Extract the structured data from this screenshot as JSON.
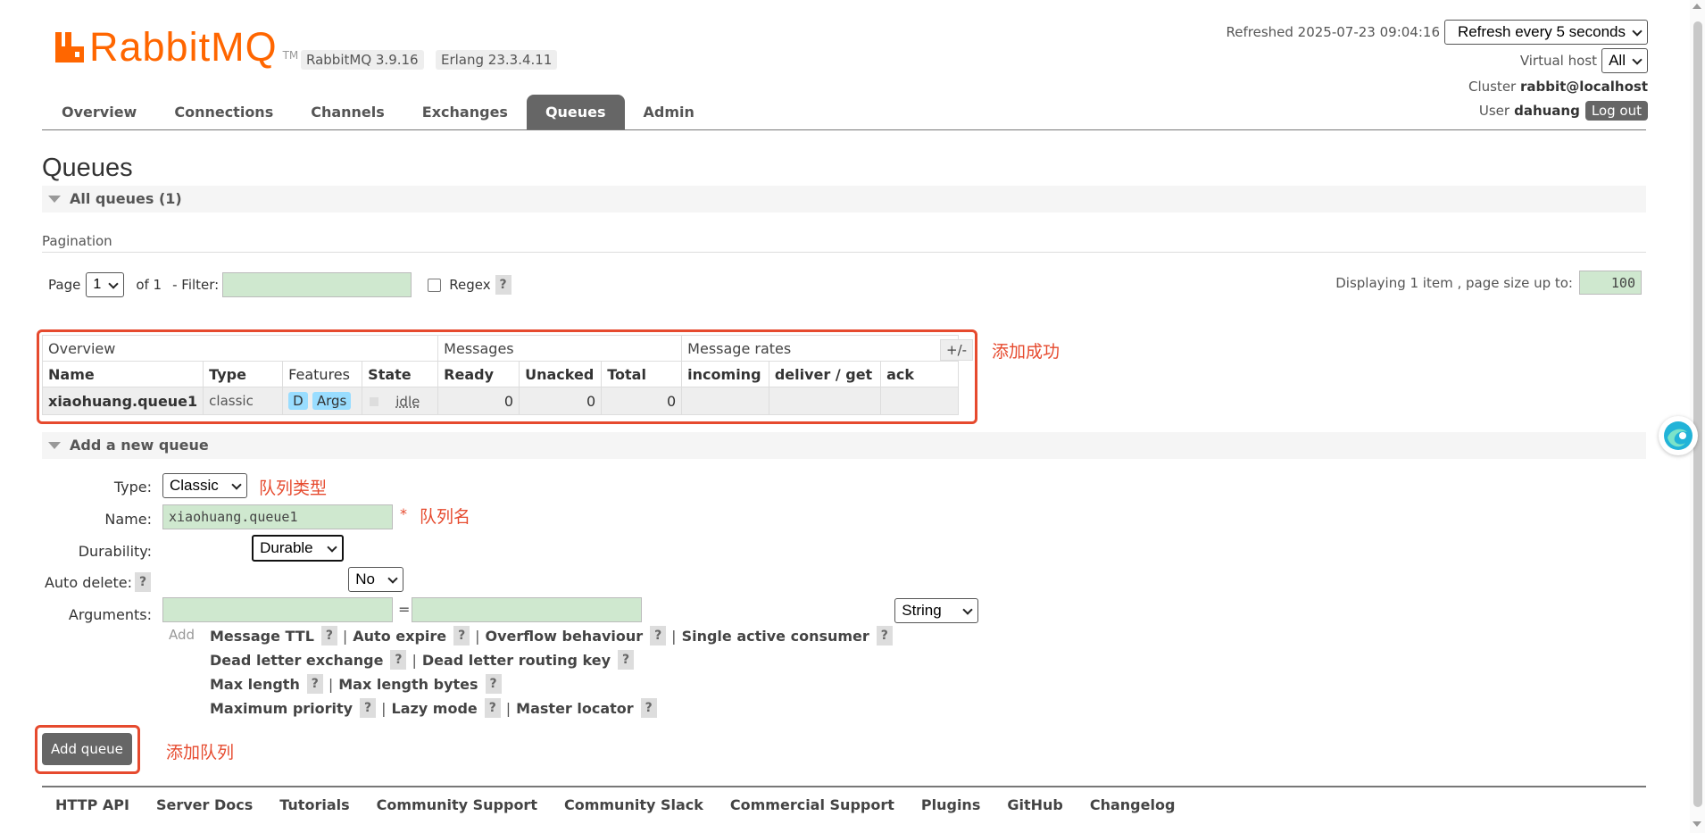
{
  "header": {
    "logo_rabbit": "RabbitMQ",
    "logo_tm": "TM",
    "version_rabbitmq": "RabbitMQ 3.9.16",
    "version_erlang": "Erlang 23.3.4.11",
    "refreshed_label": "Refreshed 2025-07-23 09:04:16",
    "refresh_select": "Refresh every 5 seconds",
    "vhost_label": "Virtual host",
    "vhost_select": "All",
    "cluster_label": "Cluster",
    "cluster_value": "rabbit@localhost",
    "user_label": "User",
    "user_value": "dahuang",
    "logout": "Log out"
  },
  "nav": {
    "tabs": [
      "Overview",
      "Connections",
      "Channels",
      "Exchanges",
      "Queues",
      "Admin"
    ],
    "active": "Queues"
  },
  "page": {
    "title": "Queues",
    "all_queues": "All queues (1)"
  },
  "pagination": {
    "heading": "Pagination",
    "page_label": "Page",
    "page_select": "1",
    "of_label": "of 1",
    "filter_label": "- Filter:",
    "filter_value": "",
    "regex_label": "Regex",
    "help": "?",
    "displaying": "Displaying 1 item , page size up to:",
    "page_size": "100"
  },
  "table": {
    "groups": [
      "Overview",
      "Messages",
      "Message rates"
    ],
    "plusminus": "+/-",
    "columns": [
      "Name",
      "Type",
      "Features",
      "State",
      "Ready",
      "Unacked",
      "Total",
      "incoming",
      "deliver / get",
      "ack"
    ],
    "rows": [
      {
        "name": "xiaohuang.queue1",
        "type": "classic",
        "feature_d": "D",
        "feature_args": "Args",
        "state": "idle",
        "ready": "0",
        "unacked": "0",
        "total": "0",
        "incoming": "",
        "deliver_get": "",
        "ack": ""
      }
    ]
  },
  "annotations": {
    "table": "添加成功",
    "type": "队列类型",
    "name": "队列名",
    "button": "添加队列"
  },
  "add_queue": {
    "heading": "Add a new queue",
    "type_label": "Type:",
    "type_value": "Classic",
    "name_label": "Name:",
    "name_value": "xiaohuang.queue1",
    "required_mark": "*",
    "durability_label": "Durability:",
    "durability_value": "Durable",
    "auto_delete_label": "Auto delete:",
    "auto_delete_value": "No",
    "arguments_label": "Arguments:",
    "arg_equals": "=",
    "arg_type": "String",
    "add_label": "Add",
    "arg_lines": [
      [
        "Message TTL",
        "Auto expire",
        "Overflow behaviour",
        "Single active consumer"
      ],
      [
        "Dead letter exchange",
        "Dead letter routing key"
      ],
      [
        "Max length",
        "Max length bytes"
      ],
      [
        "Maximum priority",
        "Lazy mode",
        "Master locator"
      ]
    ],
    "submit": "Add queue"
  },
  "footer": {
    "links": [
      "HTTP API",
      "Server Docs",
      "Tutorials",
      "Community Support",
      "Community Slack",
      "Commercial Support",
      "Plugins",
      "GitHub",
      "Changelog"
    ]
  },
  "colors": {
    "brand_orange": "#ff6600",
    "annotation_red": "#e64a2e",
    "input_green": "#cfe8cf",
    "nav_active": "#666666"
  }
}
